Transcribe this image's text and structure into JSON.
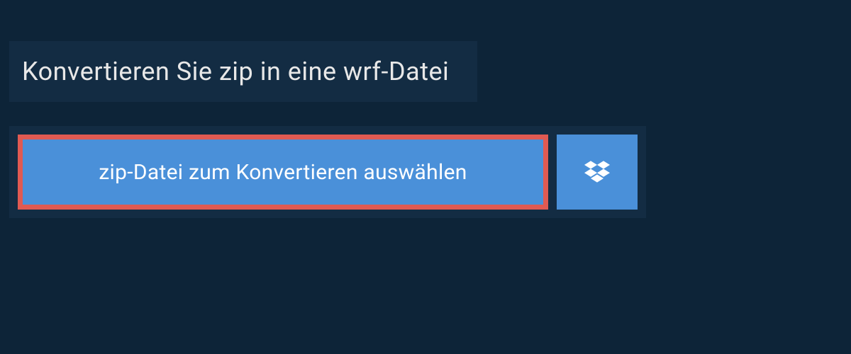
{
  "title": "Konvertieren Sie zip in eine wrf-Datei",
  "buttons": {
    "select_file_label": "zip-Datei zum Konvertieren auswählen"
  },
  "colors": {
    "background": "#0d2438",
    "panel": "#132c43",
    "button": "#4a90d9",
    "highlight_border": "#e05a52"
  }
}
